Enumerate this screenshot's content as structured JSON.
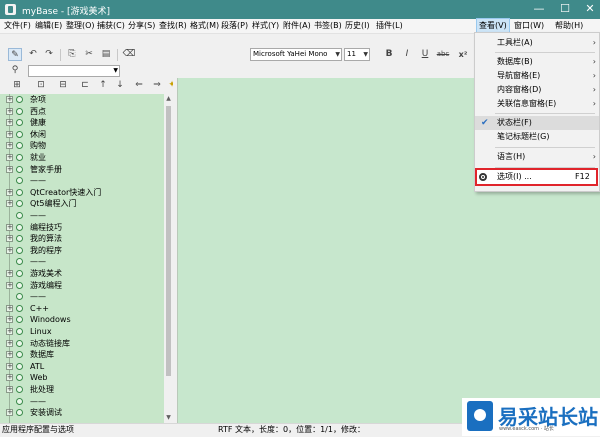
{
  "window": {
    "title": "myBase - [游戏美术]",
    "minimize": "—",
    "maximize": "☐",
    "close": "✕"
  },
  "menu": [
    "文件(F)",
    "编辑(E)",
    "整理(O)",
    "捕获(C)",
    "分享(S)",
    "查找(R)",
    "格式(M)",
    "段落(P)",
    "样式(Y)",
    "附件(A)",
    "书签(B)",
    "历史(I)",
    "插件(L)",
    "查看(V)",
    "窗口(W)",
    "帮助(H)"
  ],
  "toolbar": {
    "font": "Microsoft YaHei Mono",
    "size": "11",
    "bold": "B",
    "italic": "I",
    "underline": "U",
    "strike": "abc",
    "superscript": "x²"
  },
  "tree": [
    "杂项",
    "西点",
    "健康",
    "休闲",
    "购物",
    "就业",
    "管家手册",
    "——",
    "QtCreator快速入门",
    "Qt5编程入门",
    "——",
    "编程技巧",
    "我的算法",
    "我的程序",
    "——",
    "游戏美术",
    "游戏编程",
    "——",
    "C++",
    "Winodows",
    "Linux",
    "动态链接库",
    "数据库",
    "ATL",
    "Web",
    "批处理",
    "——",
    "安装调试"
  ],
  "dropdown": {
    "items": [
      {
        "label": "工具栏(A)",
        "submenu": true
      },
      {
        "label": "数据库(B)",
        "submenu": true
      },
      {
        "label": "导航窗格(E)",
        "submenu": true
      },
      {
        "label": "内容窗格(D)",
        "submenu": true
      },
      {
        "label": "关联信息窗格(E)",
        "submenu": true
      },
      {
        "label": "状态栏(F)",
        "checked": true
      },
      {
        "label": "笔记标题栏(G)"
      },
      {
        "label": "语言(H)",
        "submenu": true
      },
      {
        "label": "选项(I) ...",
        "shortcut": "F12"
      }
    ]
  },
  "status": {
    "hint": "应用程序配置与选项",
    "info": "RTF 文本，长度：0，位置：1/1，修改："
  },
  "watermark": {
    "text": "易采站长站",
    "sub": "www.easck.com · 站长"
  }
}
